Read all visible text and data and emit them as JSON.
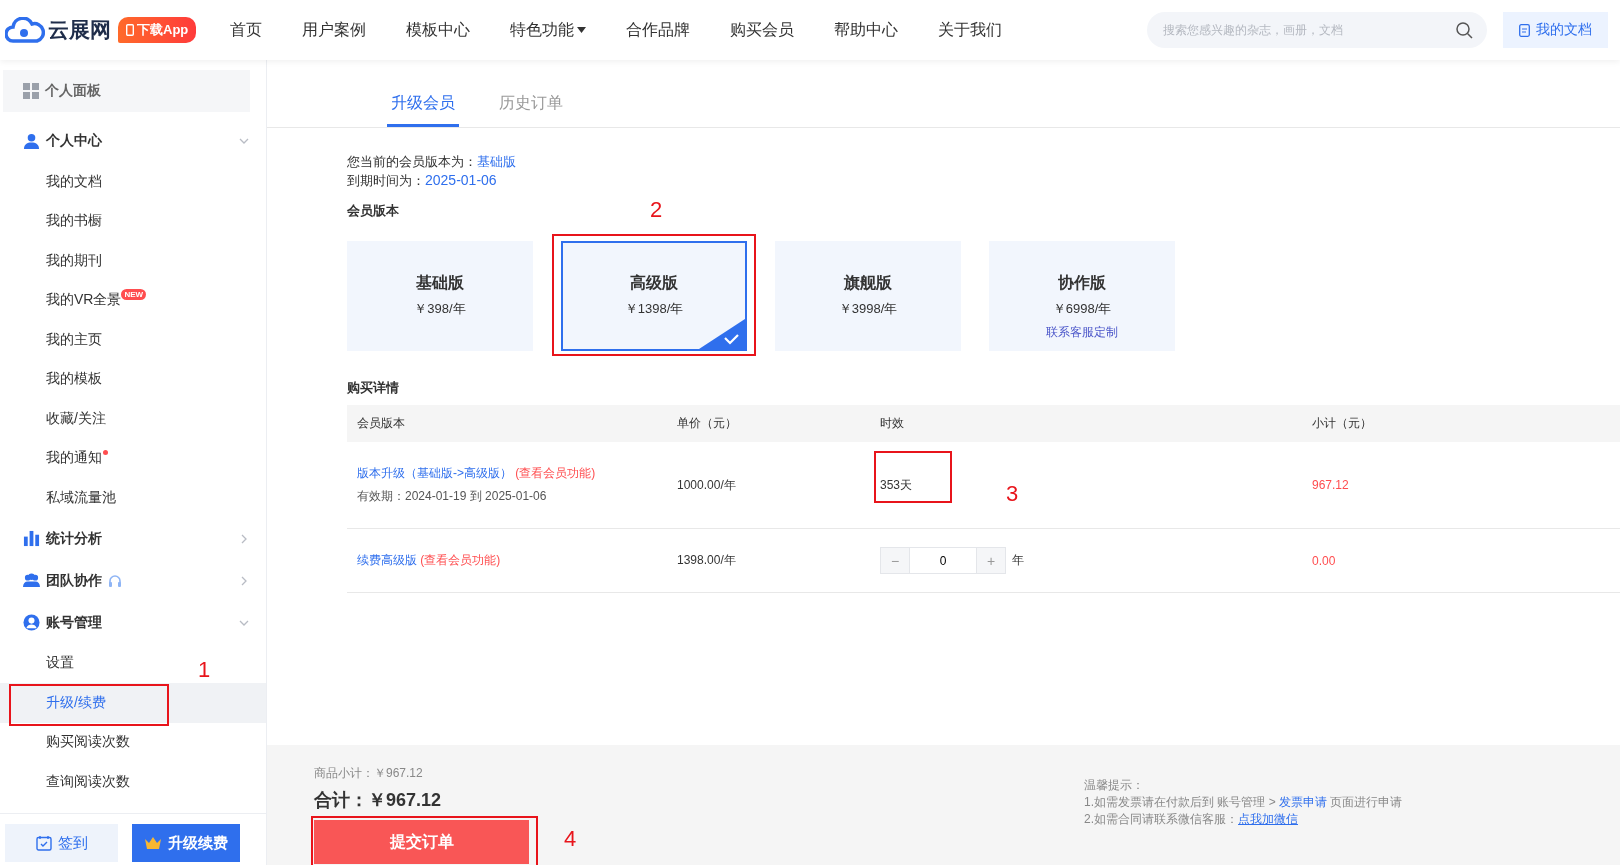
{
  "header": {
    "logo_text": "云展网",
    "app_badge": "下载App",
    "nav": [
      {
        "label": "首页",
        "dropdown": false
      },
      {
        "label": "用户案例",
        "dropdown": false
      },
      {
        "label": "模板中心",
        "dropdown": false
      },
      {
        "label": "特色功能",
        "dropdown": true
      },
      {
        "label": "合作品牌",
        "dropdown": false
      },
      {
        "label": "购买会员",
        "dropdown": false
      },
      {
        "label": "帮助中心",
        "dropdown": false
      },
      {
        "label": "关于我们",
        "dropdown": false
      }
    ],
    "search": {
      "placeholder": "搜索您感兴趣的杂志，画册，文档"
    },
    "docs_button": "我的文档"
  },
  "sidebar": {
    "dashboard": "个人面板",
    "groups": [
      {
        "label": "个人中心",
        "kind": "user",
        "expanded": true,
        "support_icon": false,
        "children": [
          {
            "label": "我的文档",
            "selected": false,
            "dot": false
          },
          {
            "label": "我的书橱",
            "selected": false,
            "dot": false
          },
          {
            "label": "我的期刊",
            "selected": false,
            "dot": false
          },
          {
            "label": "我的VR全景",
            "selected": false,
            "dot": false,
            "badge": "NEW"
          },
          {
            "label": "我的主页",
            "selected": false,
            "dot": false
          },
          {
            "label": "我的模板",
            "selected": false,
            "dot": false
          },
          {
            "label": "收藏/关注",
            "selected": false,
            "dot": false
          },
          {
            "label": "我的通知",
            "selected": false,
            "dot": true
          },
          {
            "label": "私域流量池",
            "selected": false,
            "dot": false
          }
        ]
      },
      {
        "label": "统计分析",
        "kind": "chart",
        "expanded": false,
        "support_icon": false
      },
      {
        "label": "团队协作",
        "kind": "team",
        "expanded": false,
        "support_icon": true
      },
      {
        "label": "账号管理",
        "kind": "account",
        "expanded": true,
        "support_icon": false,
        "children": [
          {
            "label": "设置",
            "selected": false,
            "dot": false
          },
          {
            "label": "升级/续费",
            "selected": true,
            "dot": false,
            "annotation": "1"
          },
          {
            "label": "购买阅读次数",
            "selected": false,
            "dot": false
          },
          {
            "label": "查询阅读次数",
            "selected": false,
            "dot": false
          }
        ]
      }
    ],
    "bottom_buttons": [
      {
        "kind": "checkin",
        "label": "签到"
      },
      {
        "kind": "upgrade",
        "label": "升级续费"
      }
    ]
  },
  "main": {
    "tabs": [
      {
        "label": "升级会员",
        "selected": true
      },
      {
        "label": "历史订单",
        "selected": false
      }
    ],
    "current_version": {
      "label": "您当前的会员版本为：",
      "value": "基础版"
    },
    "expiry": {
      "label": "到期时间为：",
      "value": "2025-01-06"
    },
    "versions_title": "会员版本",
    "versions": [
      {
        "name": "基础版",
        "price": "￥398/年",
        "selected": false
      },
      {
        "name": "高级版",
        "price": "￥1398/年",
        "selected": true,
        "annotation": "2"
      },
      {
        "name": "旗舰版",
        "price": "￥3998/年",
        "selected": false
      },
      {
        "name": "协作版",
        "price": "￥6998/年",
        "selected": false,
        "link": "联系客服定制"
      }
    ],
    "details_title": "购买详情",
    "table": {
      "columns": [
        "会员版本",
        "单价（元）",
        "时效",
        "小计（元）"
      ],
      "rows": [
        {
          "kind": "upgrade",
          "title": "版本升级（基础版->高级版）",
          "link": "(查看会员功能)",
          "validity": "有效期：2024-01-19 到 2025-01-06",
          "unit_price": "1000.00/年",
          "duration": "353天",
          "annotation": "3",
          "subtotal": "967.12"
        },
        {
          "kind": "renew",
          "title": "续费高级版",
          "link": "(查看会员功能)",
          "unit_price": "1398.00/年",
          "stepper": {
            "minus": "−",
            "value": "0",
            "plus": "+",
            "unit": "年"
          },
          "subtotal": "0.00"
        }
      ]
    }
  },
  "footer": {
    "subtotal": "商品小计：￥967.12",
    "total_label": "合计：",
    "total": "￥967.12",
    "submit": "提交订单",
    "annotation": "4",
    "tips": {
      "title": "温馨提示：",
      "line1": "1.如需发票请在付款后到 账号管理 > ",
      "line1_link": "发票申请",
      "line1_end": " 页面进行申请",
      "line2": "2.如需合同请联系微信客服：",
      "line2_link": "点我加微信"
    }
  }
}
